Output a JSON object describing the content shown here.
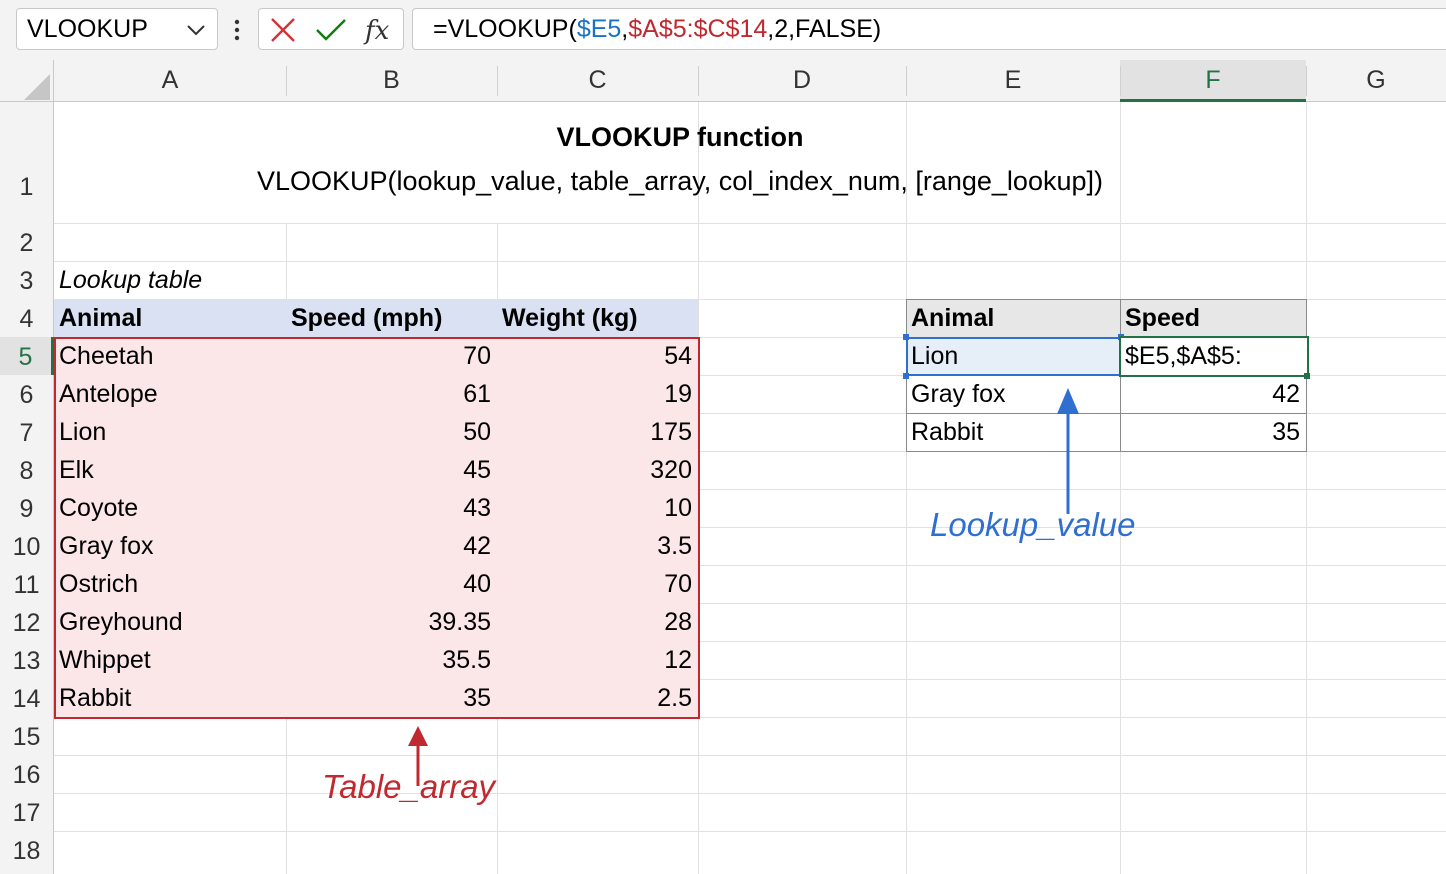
{
  "name_box": {
    "value": "VLOOKUP"
  },
  "formula_bar": {
    "prefix": "=VLOOKUP(",
    "ref1": "$E5",
    "comma1": ",",
    "ref2": "$A$5:$C$14",
    "suffix": ",2,FALSE)"
  },
  "columns": [
    "A",
    "B",
    "C",
    "D",
    "E",
    "F",
    "G"
  ],
  "rows": [
    "1",
    "2",
    "3",
    "4",
    "5",
    "6",
    "7",
    "8",
    "9",
    "10",
    "11",
    "12",
    "13",
    "14",
    "15",
    "16",
    "17",
    "18"
  ],
  "title": {
    "heading": "VLOOKUP function",
    "syntax": "VLOOKUP(lookup_value, table_array, col_index_num, [range_lookup])"
  },
  "lookup_table": {
    "caption": "Lookup table",
    "headers": [
      "Animal",
      "Speed (mph)",
      "Weight (kg)"
    ],
    "rows": [
      [
        "Cheetah",
        "70",
        "54"
      ],
      [
        "Antelope",
        "61",
        "19"
      ],
      [
        "Lion",
        "50",
        "175"
      ],
      [
        "Elk",
        "45",
        "320"
      ],
      [
        "Coyote",
        "43",
        "10"
      ],
      [
        "Gray fox",
        "42",
        "3.5"
      ],
      [
        "Ostrich",
        "40",
        "70"
      ],
      [
        "Greyhound",
        "39.35",
        "28"
      ],
      [
        "Whippet",
        "35.5",
        "12"
      ],
      [
        "Rabbit",
        "35",
        "2.5"
      ]
    ]
  },
  "result_table": {
    "headers": [
      "Animal",
      "Speed"
    ],
    "rows": [
      [
        "Lion",
        "$E5,$A$5:"
      ],
      [
        "Gray fox",
        "42"
      ],
      [
        "Rabbit",
        "35"
      ]
    ]
  },
  "annotations": {
    "table_array": "Table_array",
    "lookup_value": "Lookup_value"
  },
  "colors": {
    "accent_green": "#217346",
    "ref_blue": "#1a73c0",
    "ref_red": "#c0292f",
    "header_fill": "#d9e1f2",
    "range_fill": "#fbe6e8"
  }
}
